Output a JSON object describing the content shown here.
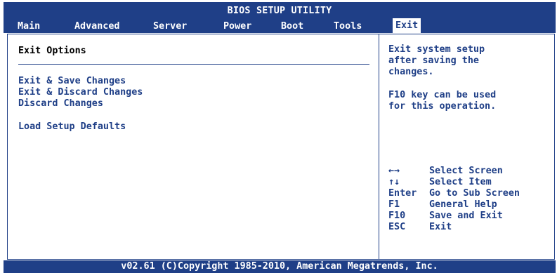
{
  "header": {
    "title": "BIOS SETUP UTILITY",
    "tabs": [
      {
        "label": "Main",
        "active": false
      },
      {
        "label": "Advanced",
        "active": false
      },
      {
        "label": "Server",
        "active": false
      },
      {
        "label": "Power",
        "active": false
      },
      {
        "label": "Boot",
        "active": false
      },
      {
        "label": "Tools",
        "active": false
      },
      {
        "label": "Exit",
        "active": true
      }
    ]
  },
  "panel": {
    "title": "Exit Options",
    "options": [
      "Exit & Save Changes",
      "Exit & Discard Changes",
      "Discard Changes",
      "Load Setup Defaults"
    ]
  },
  "help": {
    "lines": [
      "Exit system setup",
      "after saving the",
      "changes.",
      "F10 key can be used",
      "for this operation."
    ]
  },
  "keys": [
    {
      "key": "←→",
      "action": "Select Screen"
    },
    {
      "key": "↑↓",
      "action": "Select Item"
    },
    {
      "key": "Enter",
      "action": "Go to Sub Screen"
    },
    {
      "key": "F1",
      "action": "General Help"
    },
    {
      "key": "F10",
      "action": "Save and Exit"
    },
    {
      "key": "ESC",
      "action": "Exit"
    }
  ],
  "footer": {
    "text": "v02.61 (C)Copyright 1985-2010, American Megatrends, Inc."
  },
  "colors": {
    "bios_blue": "#1f3f87",
    "background": "#ffffff"
  }
}
